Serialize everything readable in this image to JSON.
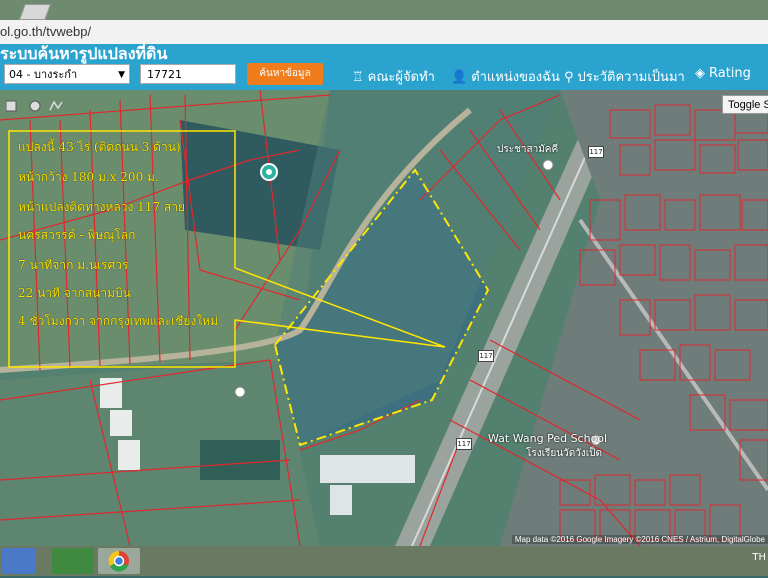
{
  "browser": {
    "url": "ol.go.th/tvwebp/"
  },
  "header": {
    "site_title": "ระบบค้นหารูปแปลงที่ดิน",
    "district_select": "04 - บางระกำ",
    "parcel_input": "17721",
    "search_button": "ค้นหาข้อมูล",
    "nav": [
      {
        "label": "คณะผู้จัดทำ",
        "icon": "lighthouse-icon"
      },
      {
        "label": "ตำแหน่งของฉัน",
        "icon": "person-icon"
      },
      {
        "label": "ประวัติความเป็นมา",
        "icon": "history-icon"
      },
      {
        "label": "Rating",
        "icon": "tag-icon"
      }
    ]
  },
  "map": {
    "toggle_button": "Toggle S",
    "annotation_color": "#ffe600",
    "parcel_line_color": "#e0282e",
    "annotation_lines": [
      "แปลงนี้ 43 ไร่ (ติดถนน 3 ด้าน)",
      "หน้ากว้าง 180 ม.x 200 ม.",
      "หน้าแปลงติดทางหลวง 117 สาย",
      "นครสวรรค์ - พิษณุโลก",
      "7 นาทีจาก ม.นเรศวร",
      "22 นาที จากสนามบิน",
      "4 ชั่วโมงกว่า จากกรุงเทพและเชียงใหม่"
    ],
    "labels": {
      "school_en": "Wat Wang Ped School",
      "school_th": "โรงเรียนวัดวังเป็ด",
      "highway_1": "117",
      "highway_2": "117",
      "highway_3": "117",
      "place_top": "ประชาสามัคคี",
      "copyright": "Map data ©2016 Google Imagery ©2016 CNES / Astrium, DigitalGlobe"
    }
  },
  "taskbar": {
    "clock_label": "TH"
  }
}
